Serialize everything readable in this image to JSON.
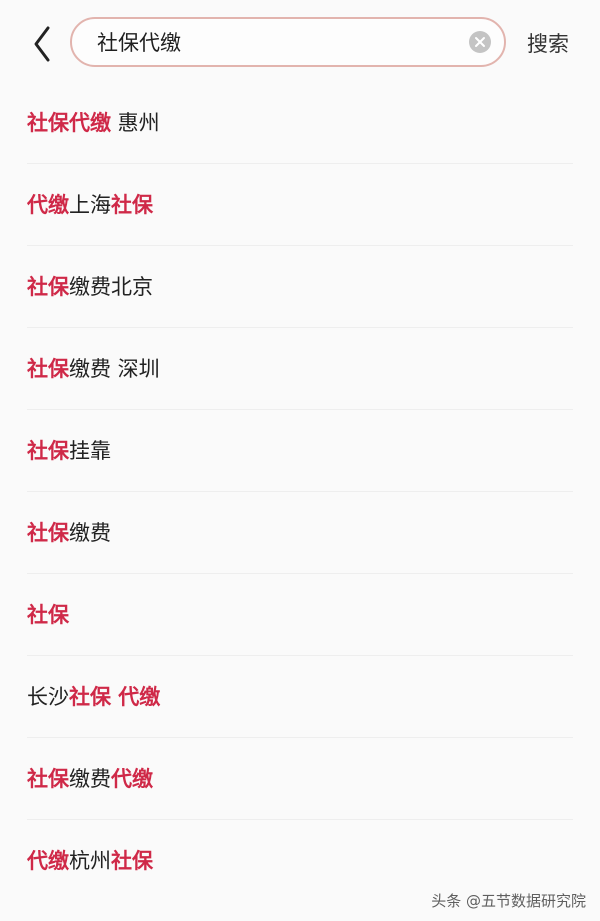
{
  "header": {
    "back_icon": "chevron-left-icon",
    "search_value": "社保代缴",
    "clear_icon": "clear-circle-icon",
    "search_button_label": "搜索",
    "search_border_color": "#e2b4ae"
  },
  "highlight_color": "#cf2948",
  "suggestions": [
    [
      {
        "text": "社保代缴",
        "hl": true
      },
      {
        "text": " 惠州",
        "hl": false
      }
    ],
    [
      {
        "text": "代缴",
        "hl": true
      },
      {
        "text": "上海",
        "hl": false
      },
      {
        "text": "社保",
        "hl": true
      }
    ],
    [
      {
        "text": "社保",
        "hl": true
      },
      {
        "text": "缴费北京",
        "hl": false
      }
    ],
    [
      {
        "text": "社保",
        "hl": true
      },
      {
        "text": "缴费 深圳",
        "hl": false
      }
    ],
    [
      {
        "text": "社保",
        "hl": true
      },
      {
        "text": "挂靠",
        "hl": false
      }
    ],
    [
      {
        "text": "社保",
        "hl": true
      },
      {
        "text": "缴费",
        "hl": false
      }
    ],
    [
      {
        "text": "社保",
        "hl": true
      }
    ],
    [
      {
        "text": "长沙",
        "hl": false
      },
      {
        "text": "社保 代缴",
        "hl": true
      }
    ],
    [
      {
        "text": "社保",
        "hl": true
      },
      {
        "text": "缴费",
        "hl": false
      },
      {
        "text": "代缴",
        "hl": true
      }
    ],
    [
      {
        "text": "代缴",
        "hl": true
      },
      {
        "text": "杭州",
        "hl": false
      },
      {
        "text": "社保",
        "hl": true
      }
    ]
  ],
  "watermark": "头条 @五节数据研究院"
}
